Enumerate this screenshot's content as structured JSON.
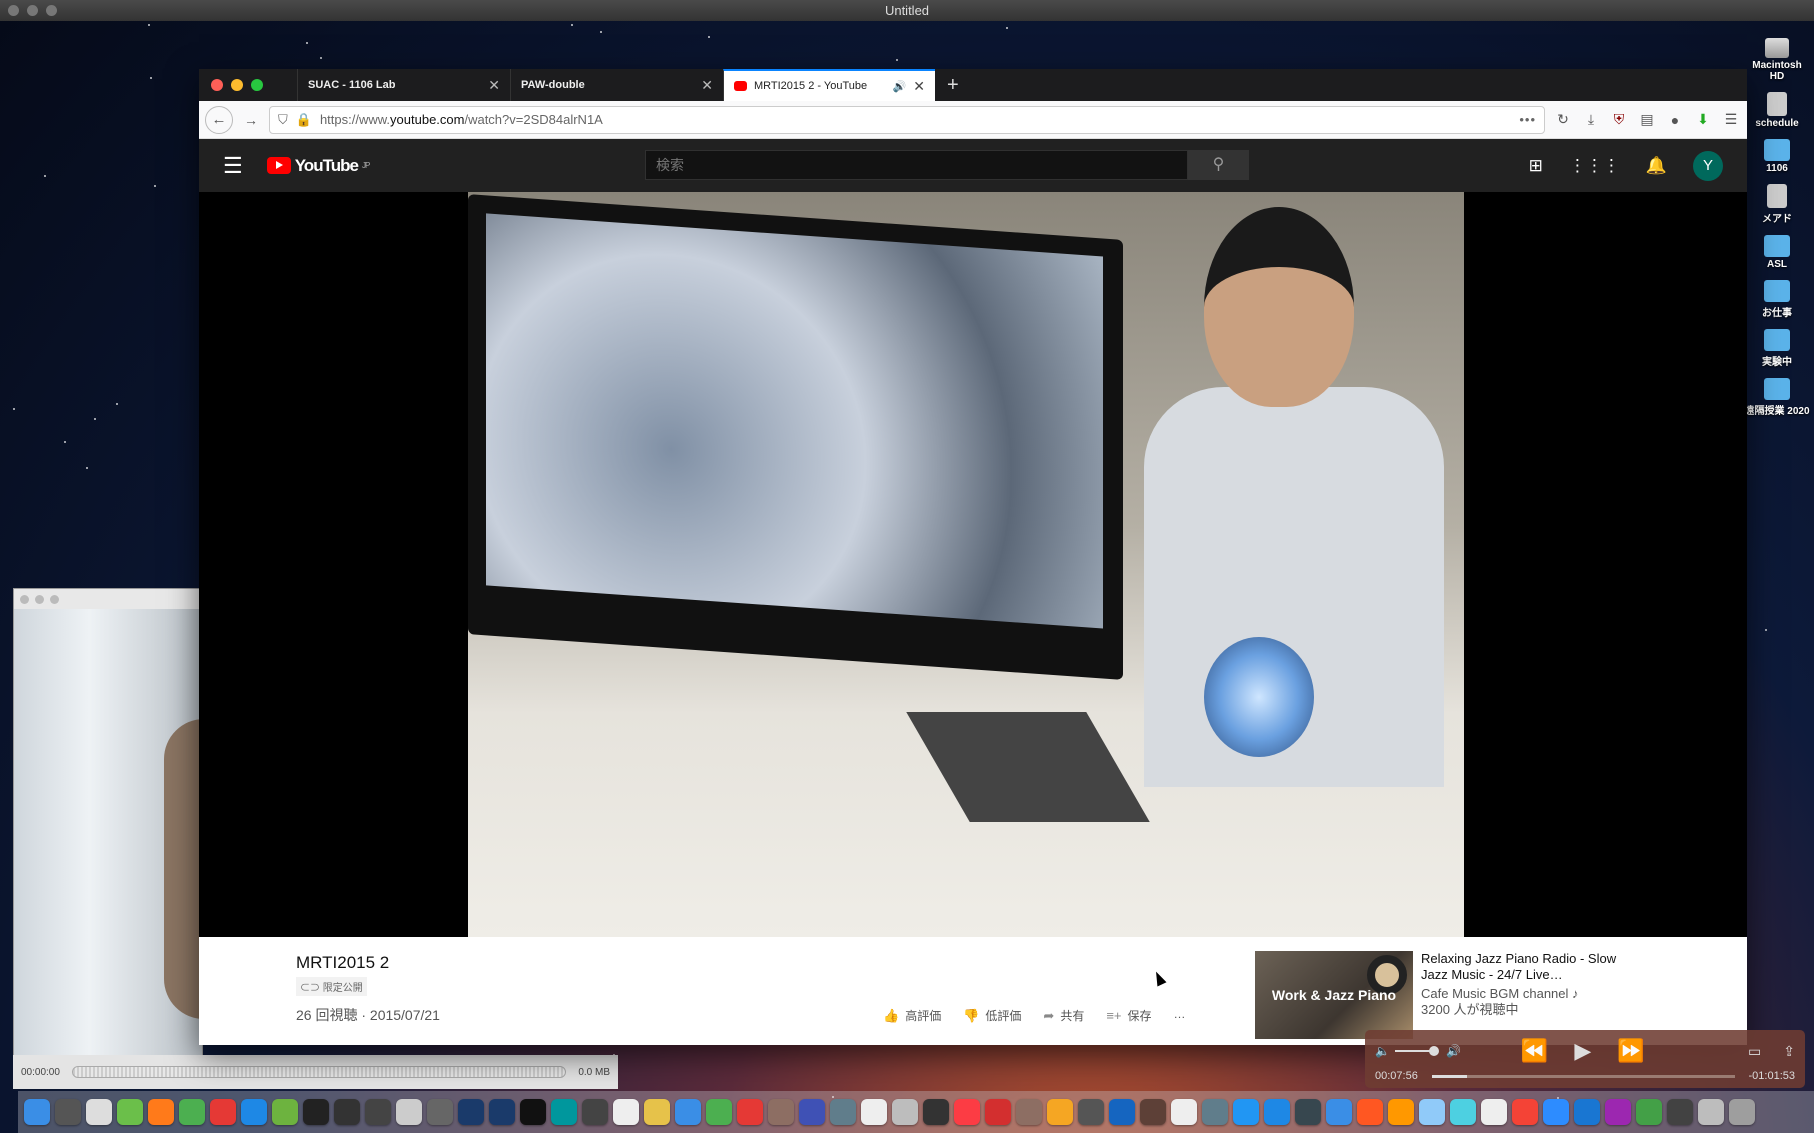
{
  "menubar": {
    "title": "Untitled"
  },
  "desktop_icons": [
    {
      "label": "Macintosh HD",
      "icon": "hard-drive-icon"
    },
    {
      "label": "schedule",
      "icon": "document-icon"
    },
    {
      "label": "1106",
      "icon": "folder-icon"
    },
    {
      "label": "メアド",
      "icon": "document-icon"
    },
    {
      "label": "ASL",
      "icon": "folder-icon"
    },
    {
      "label": "お仕事",
      "icon": "folder-icon"
    },
    {
      "label": "実験中",
      "icon": "folder-icon"
    },
    {
      "label": "遠隔授業 2020",
      "icon": "folder-icon"
    }
  ],
  "browser": {
    "tabs": [
      {
        "label": "SUAC - 1106 Lab"
      },
      {
        "label": "PAW-double"
      },
      {
        "label": "MRTI2015 2 - YouTube",
        "active": true
      }
    ],
    "url_host": "https://www.youtube.com/",
    "url_prefix": "https://www.",
    "url_domain": "youtube.com",
    "url_path": "/watch?v=2SD84alrN1A"
  },
  "youtube": {
    "logo": "YouTube",
    "region": "JP",
    "search_placeholder": "検索",
    "avatar": "Y",
    "video": {
      "title": "MRTI2015 2",
      "visibility": "限定公開",
      "views_date": "26 回視聴 · 2015/07/21"
    },
    "actions": {
      "like": "高評価",
      "dislike": "低評価",
      "share": "共有",
      "save": "保存",
      "more": "…"
    },
    "recommended": {
      "thumb_text": "Work & Jazz Piano",
      "title": "Relaxing Jazz Piano Radio - Slow Jazz Music - 24/7 Live…",
      "channel": "Cafe Music BGM channel ♪",
      "viewers": "3200 人が視聴中"
    }
  },
  "recorder": {
    "time": "00:00:00",
    "size": "0.0 MB"
  },
  "quicktime": {
    "elapsed": "00:07:56",
    "remaining": "-01:01:53",
    "progress": 0.115,
    "volume": 0.8
  },
  "dock": [
    "#3a8ee6",
    "#555",
    "#ddd",
    "#6bbf4a",
    "#ff7a1a",
    "#4caf50",
    "#e53935",
    "#1e88e5",
    "#6db33f",
    "#222",
    "#333",
    "#444",
    "#ccc",
    "#666",
    "#1a3a6a",
    "#1a3a6a",
    "#111",
    "#00979d",
    "#444",
    "#eee",
    "#e6c24a",
    "#3a8ee6",
    "#4caf50",
    "#e53935",
    "#8d6e63",
    "#3f51b5",
    "#607d8b",
    "#eee",
    "#bdbdbd",
    "#333",
    "#fc3c44",
    "#d32f2f",
    "#8d6e63",
    "#f5a623",
    "#555",
    "#1565c0",
    "#5d4037",
    "#eee",
    "#607d8b",
    "#2196f3",
    "#1e88e5",
    "#37474f",
    "#3a8ee6",
    "#ff5722",
    "#ff9800",
    "#90caf9",
    "#4dd0e1",
    "#eee",
    "#f44336",
    "#2d8cff",
    "#1976d2",
    "#9c27b0",
    "#43a047",
    "#424242",
    "#bdbdbd",
    "#9e9e9e"
  ]
}
